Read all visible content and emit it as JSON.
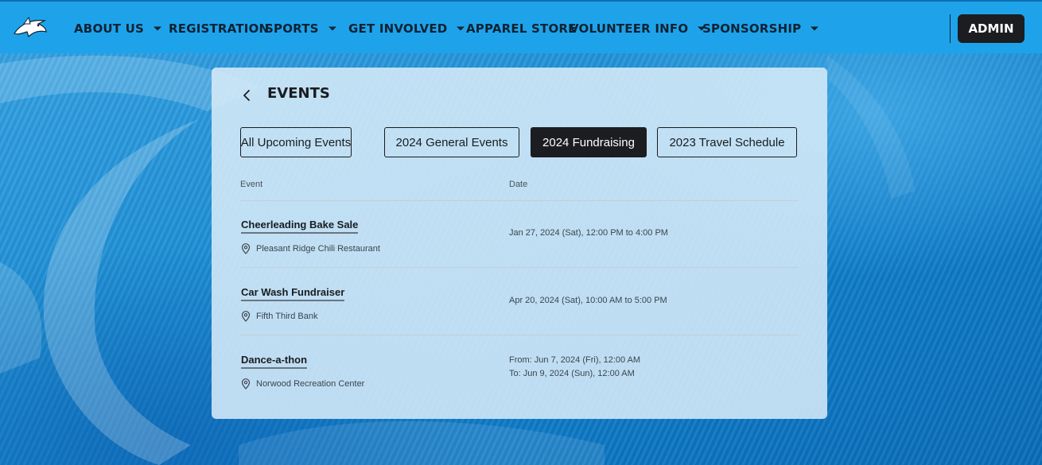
{
  "nav": {
    "logo_icon": "shark-logo-icon",
    "items": [
      {
        "label": "ABOUT US",
        "has_dropdown": true
      },
      {
        "label": "REGISTRATION",
        "has_dropdown": false
      },
      {
        "label": "SPORTS",
        "has_dropdown": true
      },
      {
        "label": "GET INVOLVED",
        "has_dropdown": true
      },
      {
        "label": "APPAREL STORE",
        "has_dropdown": false
      },
      {
        "label": "VOLUNTEER INFO",
        "has_dropdown": true
      },
      {
        "label": "SPONSORSHIP",
        "has_dropdown": true
      }
    ],
    "admin_label": "ADMIN"
  },
  "events": {
    "title": "EVENTS",
    "tabs": [
      {
        "label": "All Upcoming Events",
        "active": false
      },
      {
        "label": "2024 General Events",
        "active": false
      },
      {
        "label": "2024 Fundraising",
        "active": true
      },
      {
        "label": "2023 Travel Schedule",
        "active": false
      }
    ],
    "columns": {
      "event": "Event",
      "date": "Date"
    },
    "rows": [
      {
        "name": "Cheerleading Bake Sale",
        "location": "Pleasant Ridge Chili Restaurant",
        "date_line1": "Jan 27, 2024 (Sat), 12:00 PM to 4:00 PM",
        "date_line2": ""
      },
      {
        "name": "Car Wash Fundraiser",
        "location": "Fifth Third Bank",
        "date_line1": "Apr 20, 2024 (Sat), 10:00 AM to 5:00 PM",
        "date_line2": ""
      },
      {
        "name": "Dance-a-thon",
        "location": "Norwood Recreation Center",
        "date_line1": "From: Jun 7, 2024 (Fri), 12:00 AM",
        "date_line2": "To: Jun 9, 2024 (Sun), 12:00 AM"
      }
    ]
  },
  "colors": {
    "nav_bg": "#1ea3ea",
    "active_tab": "#1b1d20",
    "admin_bg": "#1b1d20"
  }
}
